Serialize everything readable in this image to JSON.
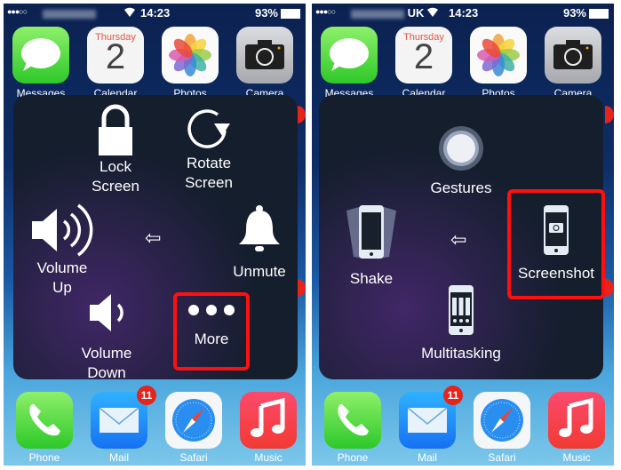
{
  "status_bar": {
    "signal": "●●●○○",
    "carrier_left": "",
    "carrier_right": "UK",
    "time": "14:23",
    "battery": "93%"
  },
  "top_apps": [
    {
      "label": "Messages",
      "icon": "messages-icon"
    },
    {
      "label": "Calendar",
      "icon": "calendar-icon",
      "day": "Thursday",
      "date": "2"
    },
    {
      "label": "Photos",
      "icon": "photos-icon"
    },
    {
      "label": "Camera",
      "icon": "camera-icon"
    }
  ],
  "dock_apps": [
    {
      "label": "Phone",
      "icon": "phone-icon"
    },
    {
      "label": "Mail",
      "icon": "mail-icon",
      "badge": "11"
    },
    {
      "label": "Safari",
      "icon": "safari-icon"
    },
    {
      "label": "Music",
      "icon": "music-icon"
    }
  ],
  "panel_left": {
    "lock_screen": "Lock\nScreen",
    "lock_l1": "Lock",
    "lock_l2": "Screen",
    "rotate_l1": "Rotate",
    "rotate_l2": "Screen",
    "volume_up_l1": "Volume",
    "volume_up_l2": "Up",
    "unmute": "Unmute",
    "volume_down_l1": "Volume",
    "volume_down_l2": "Down",
    "more": "More",
    "back_arrow": "⇦"
  },
  "panel_right": {
    "gestures": "Gestures",
    "shake": "Shake",
    "screenshot": "Screenshot",
    "multitasking": "Multitasking",
    "back_arrow": "⇦"
  },
  "colors": {
    "highlight": "#ff1010",
    "badge": "#e5241c"
  }
}
